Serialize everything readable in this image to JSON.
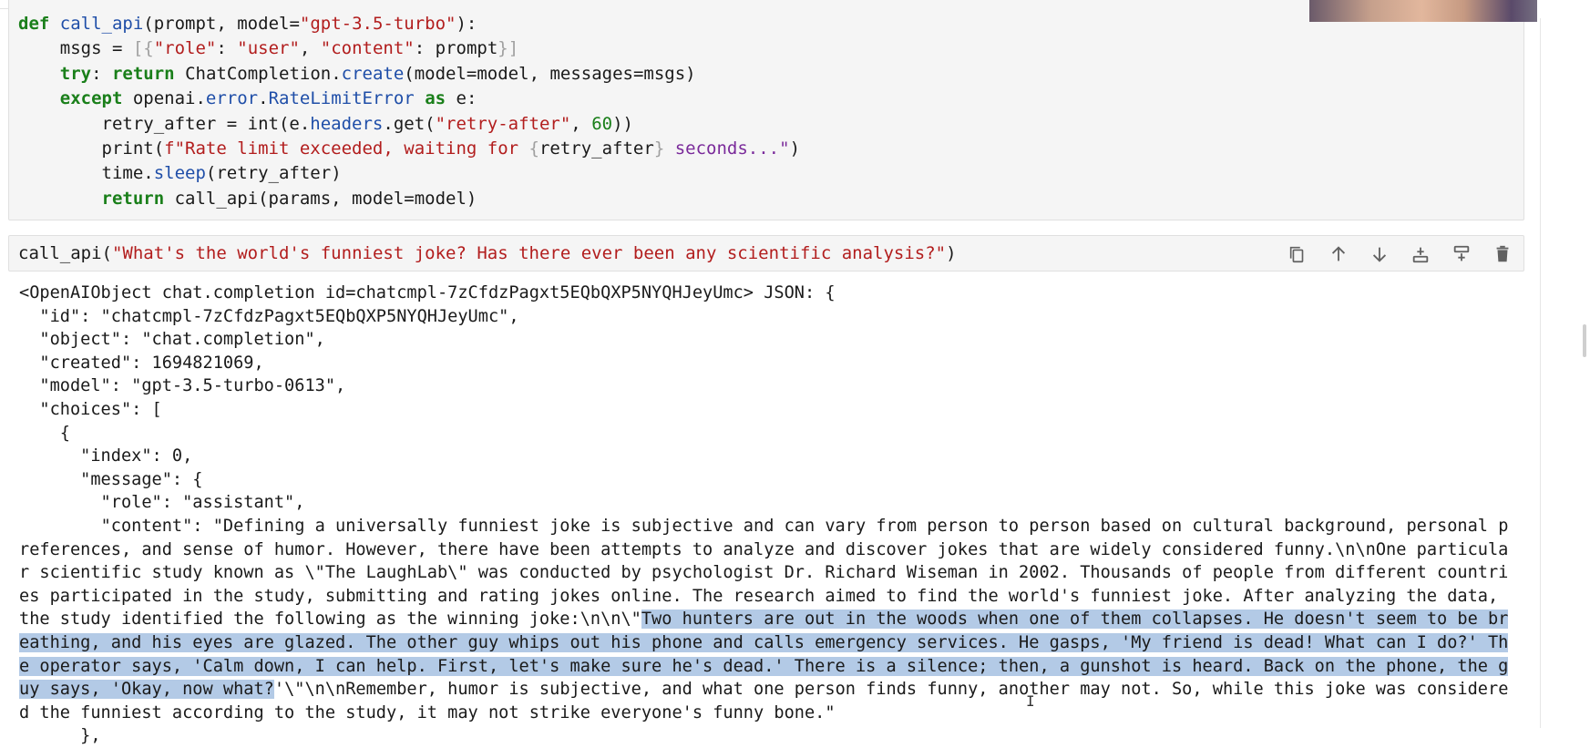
{
  "cell1": {
    "lines": [
      "def call_api(prompt, model=\"gpt-3.5-turbo\"):",
      "    msgs = [{\"role\": \"user\", \"content\": prompt}]",
      "    try: return ChatCompletion.create(model=model, messages=msgs)",
      "    except openai.error.RateLimitError as e:",
      "        retry_after = int(e.headers.get(\"retry-after\", 60))",
      "        print(f\"Rate limit exceeded, waiting for {retry_after} seconds...\")",
      "        time.sleep(retry_after)",
      "        return call_api(params, model=model)"
    ]
  },
  "cell2": {
    "fn": "call_api",
    "arg": "\"What's the world's funniest joke? Has there ever been any scientific analysis?\"",
    "toolbar": [
      {
        "name": "copy-icon",
        "label": "Duplicate"
      },
      {
        "name": "move-up-icon",
        "label": "Move up"
      },
      {
        "name": "move-down-icon",
        "label": "Move down"
      },
      {
        "name": "insert-below-icon",
        "label": "Insert below"
      },
      {
        "name": "insert-above-icon",
        "label": "Insert above"
      },
      {
        "name": "trash-icon",
        "label": "Delete"
      }
    ]
  },
  "output": {
    "header_lines": [
      "<OpenAIObject chat.completion id=chatcmpl-7zCfdzPagxt5EQbQXP5NYQHJeyUmc> JSON: {",
      "  \"id\": \"chatcmpl-7zCfdzPagxt5EQbQXP5NYQHJeyUmc\",",
      "  \"object\": \"chat.completion\",",
      "  \"created\": 1694821069,",
      "  \"model\": \"gpt-3.5-turbo-0613\",",
      "  \"choices\": [",
      "    {",
      "      \"index\": 0,",
      "      \"message\": {",
      "        \"role\": \"assistant\","
    ],
    "content_before": "        \"content\": \"Defining a universally funniest joke is subjective and can vary from person to person based on cultural background, personal preferences, and sense of humor. However, there have been attempts to analyze and discover jokes that are widely considered funny.\\n\\nOne particular scientific study known as \\\"The LaughLab\\\" was conducted by psychologist Dr. Richard Wiseman in 2002. Thousands of people from different countries participated in the study, submitting and rating jokes online. The research aimed to find the world's funniest joke. After analyzing the data, the study identified the following as the winning joke:\\n\\n\\\"",
    "content_highlight": "Two hunters are out in the woods when one of them collapses. He doesn't seem to be breathing, and his eyes are glazed. The other guy whips out his phone and calls emergency services. He gasps, 'My friend is dead! What can I do?' The operator says, 'Calm down, I can help. First, let's make sure he's dead.' There is a silence; then, a gunshot is heard. Back on the phone, the guy says, 'Okay, now what?",
    "content_after": "'\\\"\\n\\nRemember, humor is subjective, and what one person finds funny, another may not. So, while this joke was considered the funniest according to the study, it may not strike everyone's funny bone.\"",
    "tail": "      },"
  }
}
